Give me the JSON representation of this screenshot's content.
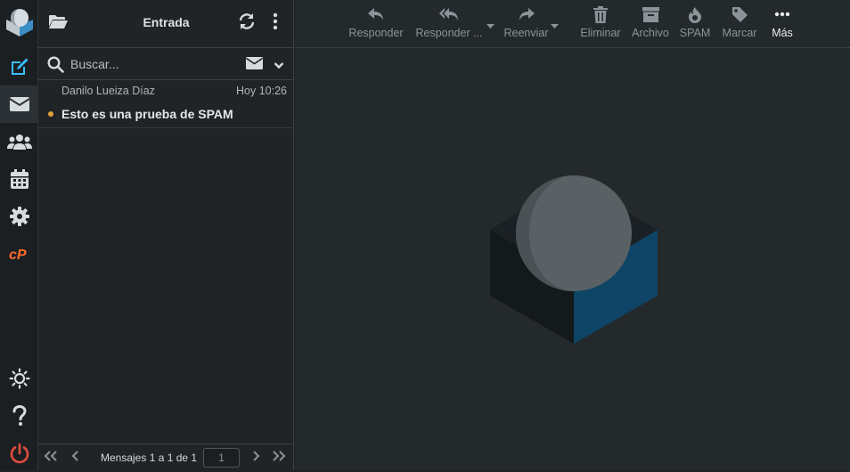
{
  "list": {
    "folder_title": "Entrada",
    "search_placeholder": "Buscar...",
    "messages": [
      {
        "from": "Danilo Lueiza Díaz",
        "date": "Hoy 10:26",
        "subject": "Esto es una prueba de SPAM",
        "unread": true
      }
    ],
    "pager": {
      "count_text": "Mensajes 1 a 1 de 1",
      "page_value": "1"
    }
  },
  "toolbar": {
    "reply": "Responder",
    "reply_all": "Responder ...",
    "forward": "Reenviar",
    "delete": "Eliminar",
    "archive": "Archivo",
    "spam": "SPAM",
    "mark": "Marcar",
    "more": "Más"
  },
  "nav": {
    "icons": [
      "compose-icon",
      "mail-icon",
      "contacts-icon",
      "calendar-icon",
      "settings-icon",
      "cpanel-icon",
      "theme-icon",
      "help-icon",
      "logout-icon"
    ]
  },
  "colors": {
    "accent": "#37beff",
    "unread_dot": "#e0a23a",
    "logout": "#e04b3c",
    "cpanel": "#ff6c2c"
  }
}
